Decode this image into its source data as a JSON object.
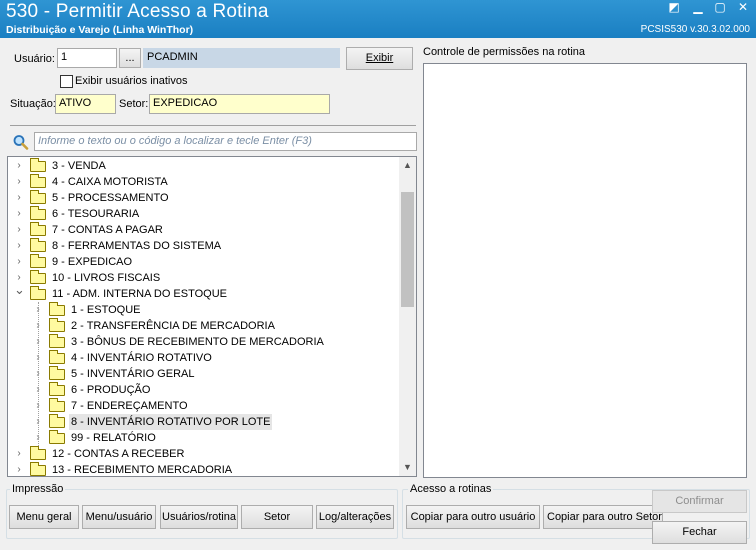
{
  "window": {
    "title": "530 - Permitir Acesso a Rotina",
    "subtitle": "Distribuição e Varejo (Linha WinThor)",
    "code": "PCSIS530  v.30.3.02.000"
  },
  "form": {
    "usuario_label": "Usuário:",
    "usuario_value": "1",
    "browse_label": "...",
    "usuario_name": "PCADMIN",
    "exibir_button": "Exibir",
    "inativos_label": "Exibir usuários inativos",
    "situacao_label": "Situação:",
    "situacao_value": "ATIVO",
    "setor_label": "Setor:",
    "setor_value": "EXPEDICAO",
    "search_placeholder": "Informe o texto ou o código a localizar e tecle Enter (F3)"
  },
  "right_panel": {
    "title": "Controle de permissões na rotina"
  },
  "tree": [
    {
      "label": "3 - VENDA",
      "level": 0,
      "expanded": false
    },
    {
      "label": "4 - CAIXA MOTORISTA",
      "level": 0,
      "expanded": false
    },
    {
      "label": "5 - PROCESSAMENTO",
      "level": 0,
      "expanded": false
    },
    {
      "label": "6 - TESOURARIA",
      "level": 0,
      "expanded": false
    },
    {
      "label": "7 - CONTAS A PAGAR",
      "level": 0,
      "expanded": false
    },
    {
      "label": "8 - FERRAMENTAS DO SISTEMA",
      "level": 0,
      "expanded": false
    },
    {
      "label": "9 - EXPEDICAO",
      "level": 0,
      "expanded": false
    },
    {
      "label": "10 - LIVROS FISCAIS",
      "level": 0,
      "expanded": false
    },
    {
      "label": "11 - ADM. INTERNA DO ESTOQUE",
      "level": 0,
      "expanded": true
    },
    {
      "label": "1 - ESTOQUE",
      "level": 1,
      "expanded": false
    },
    {
      "label": "2 - TRANSFERÊNCIA DE MERCADORIA",
      "level": 1,
      "expanded": false
    },
    {
      "label": "3 - BÔNUS DE RECEBIMENTO DE MERCADORIA",
      "level": 1,
      "expanded": false
    },
    {
      "label": "4 - INVENTÁRIO ROTATIVO",
      "level": 1,
      "expanded": false
    },
    {
      "label": "5 - INVENTÁRIO GERAL",
      "level": 1,
      "expanded": false
    },
    {
      "label": "6 - PRODUÇÃO",
      "level": 1,
      "expanded": false
    },
    {
      "label": "7 - ENDEREÇAMENTO",
      "level": 1,
      "expanded": false
    },
    {
      "label": "8 - INVENTÁRIO ROTATIVO POR LOTE",
      "level": 1,
      "expanded": false,
      "selected": true
    },
    {
      "label": "99 - RELATÓRIO",
      "level": 1,
      "expanded": false
    },
    {
      "label": "12 - CONTAS A RECEBER",
      "level": 0,
      "expanded": false
    },
    {
      "label": "13 - RECEBIMENTO MERCADORIA",
      "level": 0,
      "expanded": false
    }
  ],
  "impressao": {
    "title": "Impressão",
    "buttons": [
      "Menu geral",
      "Menu/usuário",
      "Usuários/rotina",
      "Setor",
      "Log/alterações"
    ]
  },
  "acesso": {
    "title": "Acesso a rotinas",
    "buttons": [
      "Copiar para outro usuário",
      "Copiar para outro Setor"
    ]
  },
  "actions": {
    "confirmar": "Confirmar",
    "fechar": "Fechar"
  }
}
